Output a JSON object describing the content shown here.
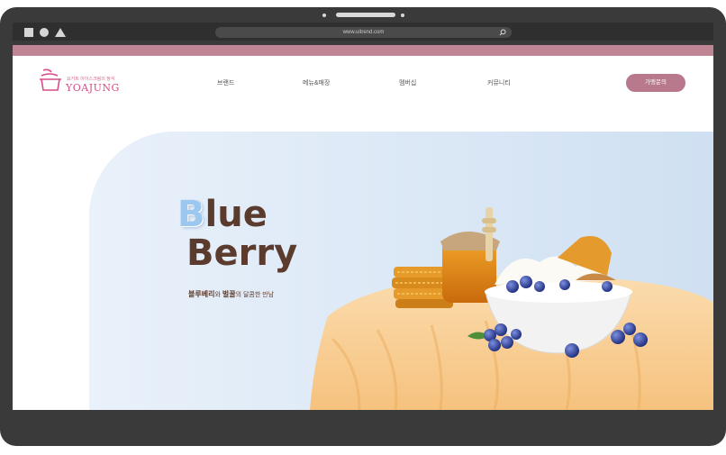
{
  "browser": {
    "url": "www.uitrend.com",
    "controls": [
      "square-icon",
      "circle-icon",
      "triangle-icon"
    ]
  },
  "header": {
    "logo_tagline": "요거트 아이스크림의 정석",
    "logo_brand": "YOAJUNG",
    "nav": [
      {
        "label": "브랜드"
      },
      {
        "label": "메뉴&매장"
      },
      {
        "label": "멤버십"
      },
      {
        "label": "커뮤니티"
      }
    ],
    "cta_label": "가맹문의"
  },
  "hero": {
    "title_first_letter": "B",
    "title_rest": "lue",
    "title_line2": "Berry",
    "subtitle_part1": "블루베리",
    "subtitle_part2": "와 ",
    "subtitle_part3": "벌꿀",
    "subtitle_part4": "의 달콤한 만남"
  },
  "colors": {
    "accent_pink": "#bf8594",
    "cta": "#b8798d",
    "logo_pink": "#d64c86",
    "hero_bg": "#d9e7f5",
    "title_brown": "#5b3b2e",
    "title_blue": "#9cc7ef"
  }
}
